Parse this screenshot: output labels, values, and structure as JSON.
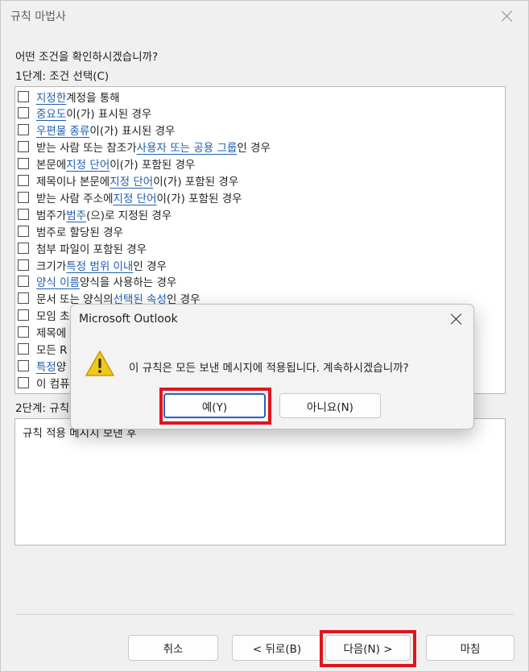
{
  "window": {
    "title": "규칙 마법사"
  },
  "wizard": {
    "question": "어떤 조건을 확인하시겠습니까?",
    "step1_label": "1단계: 조건 선택(C)",
    "conditions": [
      {
        "parts": [
          {
            "t": "지정한",
            "link": true
          },
          {
            "t": " 계정을 통해"
          }
        ]
      },
      {
        "parts": [
          {
            "t": "중요도",
            "link": true
          },
          {
            "t": "이(가) 표시된 경우"
          }
        ]
      },
      {
        "parts": [
          {
            "t": "우편물 종류",
            "link": true
          },
          {
            "t": "이(가) 표시된 경우"
          }
        ]
      },
      {
        "parts": [
          {
            "t": "받는 사람 또는 참조가 "
          },
          {
            "t": "사용자 또는 공용 그룹",
            "link": true
          },
          {
            "t": "인 경우"
          }
        ]
      },
      {
        "parts": [
          {
            "t": "본문에 "
          },
          {
            "t": "지정 단어",
            "link": true
          },
          {
            "t": "이(가) 포함된 경우"
          }
        ]
      },
      {
        "parts": [
          {
            "t": "제목이나 본문에 "
          },
          {
            "t": "지정 단어",
            "link": true
          },
          {
            "t": "이(가) 포함된 경우"
          }
        ]
      },
      {
        "parts": [
          {
            "t": "받는 사람 주소에 "
          },
          {
            "t": "지정 단어",
            "link": true
          },
          {
            "t": "이(가) 포함된 경우"
          }
        ]
      },
      {
        "parts": [
          {
            "t": "범주가 "
          },
          {
            "t": "범주",
            "link": true
          },
          {
            "t": "(으)로 지정된 경우"
          }
        ]
      },
      {
        "parts": [
          {
            "t": "범주로 할당된 경우"
          }
        ]
      },
      {
        "parts": [
          {
            "t": "첨부 파일이 포함된 경우"
          }
        ]
      },
      {
        "parts": [
          {
            "t": "크기가 "
          },
          {
            "t": "특정 범위 이내",
            "link": true
          },
          {
            "t": "인 경우"
          }
        ]
      },
      {
        "parts": [
          {
            "t": "양식 이름",
            "link": true
          },
          {
            "t": " 양식을 사용하는 경우"
          }
        ]
      },
      {
        "parts": [
          {
            "t": "문서 또는 양식의 "
          },
          {
            "t": "선택된 속성",
            "link": true
          },
          {
            "t": "인 경우"
          }
        ]
      },
      {
        "parts": [
          {
            "t": "모임 초"
          }
        ]
      },
      {
        "parts": [
          {
            "t": "제목에"
          }
        ]
      },
      {
        "parts": [
          {
            "t": "모든 R"
          }
        ]
      },
      {
        "parts": [
          {
            "t": "특정",
            "link": true
          },
          {
            "t": " 양"
          }
        ]
      },
      {
        "parts": [
          {
            "t": "이 컴퓨"
          }
        ]
      }
    ],
    "step2_label": "2단계: 규칙",
    "description": "규칙 적용   메시지 보낸 후",
    "buttons": {
      "cancel": "취소",
      "back": "< 뒤로(B)",
      "next": "다음(N) >",
      "finish": "마침"
    }
  },
  "dialog": {
    "title": "Microsoft Outlook",
    "message": "이 규칙은 모든 보낸 메시지에 적용됩니다. 계속하시겠습니까?",
    "yes": "예(Y)",
    "no": "아니요(N)"
  },
  "colors": {
    "link": "#1f5fb0",
    "highlight": "#e0141e",
    "warning": "#f2c81a"
  }
}
